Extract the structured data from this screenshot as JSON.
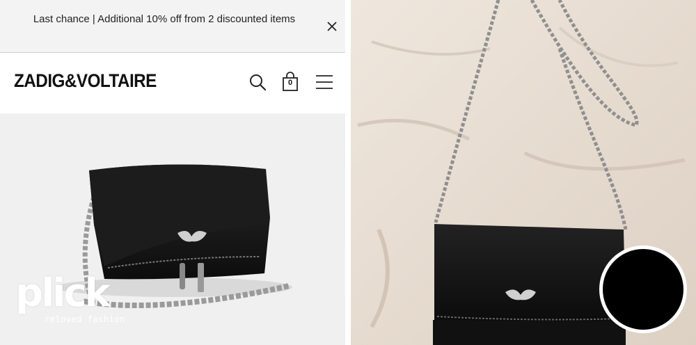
{
  "promo": {
    "text": "Last chance | Additional 10% off from 2 discounted items",
    "close_icon": "close-icon"
  },
  "header": {
    "logo": "ZADIG&VOLTAIRE",
    "cart_count": "0",
    "icons": [
      "search-icon",
      "shopping-bag-icon",
      "hamburger-menu-icon"
    ]
  },
  "watermark": {
    "brand": "plick",
    "tagline": "reloved fashion"
  },
  "colors": {
    "promo_bg": "#f3f3f3",
    "product_bg": "#f0f0f0",
    "photo_bg": "#ebe2d8",
    "bag": "#141414",
    "chain": "#9a9a9a"
  }
}
